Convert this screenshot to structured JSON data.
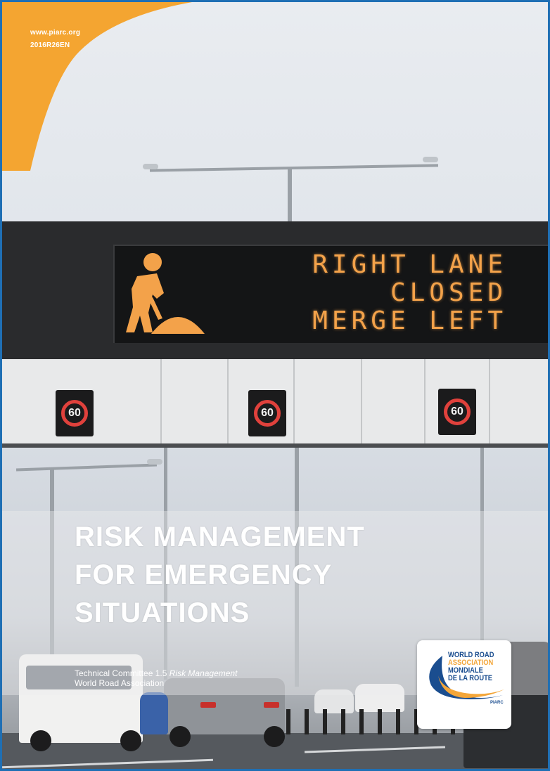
{
  "header": {
    "url": "www.piarc.org",
    "code": "2016R26EN"
  },
  "colors": {
    "frame": "#1f6fb4",
    "corner": "#f4a531",
    "vms_text": "#f3a24a",
    "logo_blue": "#1a4d8f",
    "logo_orange": "#f3a63a"
  },
  "sign": {
    "lines": [
      "RIGHT LANE",
      "CLOSED",
      "MERGE LEFT"
    ],
    "icon": "roadworks-worker-icon",
    "speed_limits": [
      "60",
      "60",
      "60"
    ]
  },
  "title": {
    "lines": [
      "RISK MANAGEMENT",
      "FOR EMERGENCY",
      "SITUATIONS"
    ]
  },
  "committee": {
    "prefix": "Technical Committee 1.5 ",
    "topic": "Risk Management",
    "association": "World Road Association"
  },
  "logo": {
    "line1": "WORLD ROAD",
    "line2": "ASSOCIATION",
    "line3": "MONDIALE",
    "line4": "DE LA ROUTE",
    "tag": "PIARC"
  }
}
